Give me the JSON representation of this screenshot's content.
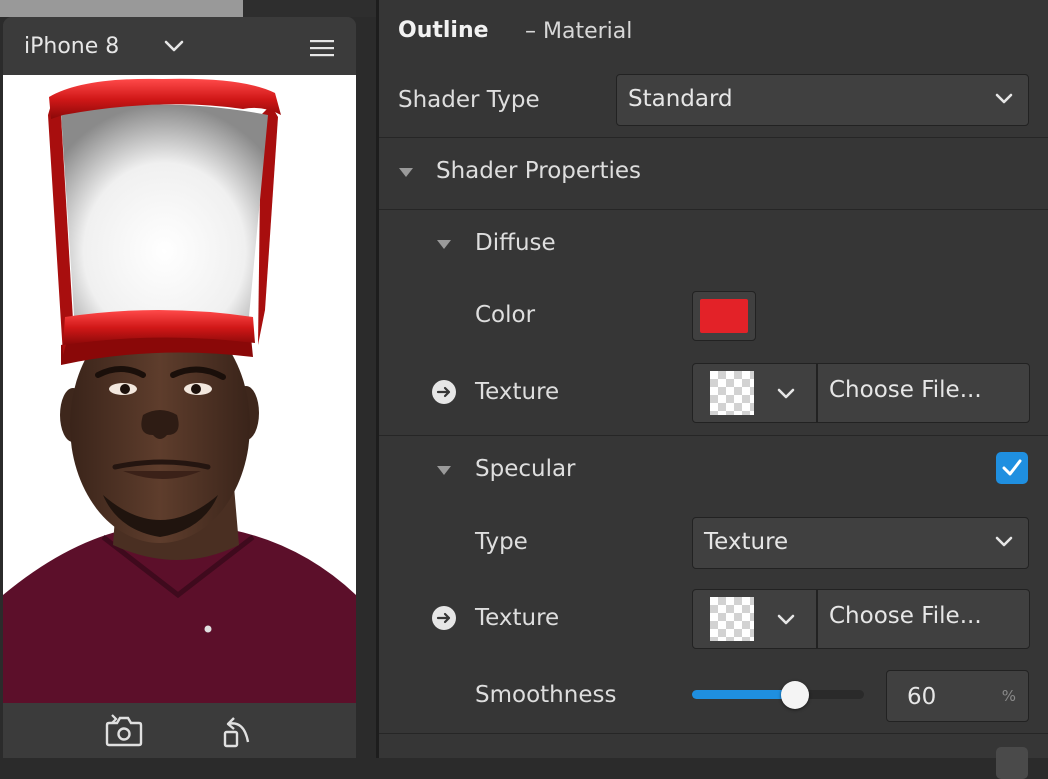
{
  "preview": {
    "device_name": "iPhone 8",
    "colors": {
      "hat_red": "#d11818",
      "shirt": "#5c0f2a",
      "background": "#ffffff"
    },
    "icons": [
      "chevron-down-icon",
      "menu-icon",
      "switch-camera-icon",
      "rotate-icon"
    ]
  },
  "inspector": {
    "title": "Outline",
    "subtitle": "– Material",
    "shader_type_label": "Shader Type",
    "shader_type_value": "Standard",
    "shader_properties_label": "Shader Properties",
    "diffuse": {
      "label": "Diffuse",
      "color_label": "Color",
      "color_value": "#e32228",
      "texture_label": "Texture",
      "choose_file": "Choose File..."
    },
    "specular": {
      "label": "Specular",
      "enabled": true,
      "type_label": "Type",
      "type_value": "Texture",
      "texture_label": "Texture",
      "choose_file": "Choose File...",
      "smoothness_label": "Smoothness",
      "smoothness_value": "60",
      "smoothness_unit": "%",
      "smoothness_fraction": 0.6
    },
    "accent_color": "#1f8fe0"
  }
}
